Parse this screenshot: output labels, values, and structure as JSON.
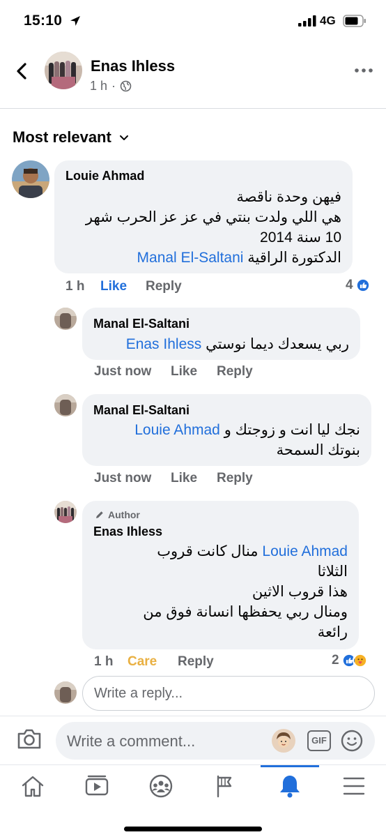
{
  "status_bar": {
    "time": "15:10",
    "network": "4G"
  },
  "header": {
    "name": "Enas Ihless",
    "time": "1 h"
  },
  "sort": {
    "label": "Most relevant"
  },
  "comments": [
    {
      "name": "Louie Ahmad",
      "lines": [
        "فيهن وحدة ناقصة",
        "هي اللي ولدت بنتي في عز عز الحرب شهر",
        "10 سنة 2014"
      ],
      "last_line_text": "الدكتورة الراقية",
      "mention": "Manal El-Saltani",
      "time": "1 h",
      "like": "Like",
      "reply": "Reply",
      "reaction_count": "4"
    },
    {
      "name": "Manal El-Saltani",
      "mention": "Enas Ihless",
      "text": "ربي يسعدك ديما نوستي",
      "time": "Just now",
      "like": "Like",
      "reply": "Reply"
    },
    {
      "name": "Manal El-Saltani",
      "mention": "Louie Ahmad",
      "text": "نجك ليا انت و زوجتك و",
      "line2": "بنوتك السمحة",
      "time": "Just now",
      "like": "Like",
      "reply": "Reply"
    },
    {
      "author_badge": "Author",
      "name": "Enas Ihless",
      "mention": "Louie Ahmad",
      "text": "منال كانت قروب",
      "lines": [
        "الثلاثا",
        "هذا قروب الاثين",
        "ومنال ربي يحفظها انسانة فوق من",
        "رائعة"
      ],
      "time": "1 h",
      "care": "Care",
      "reply": "Reply",
      "reaction_count": "2"
    }
  ],
  "reply_input": {
    "placeholder": "Write a reply..."
  },
  "composer": {
    "placeholder": "Write a comment...",
    "gif_label": "GIF"
  },
  "tabs": [
    "home",
    "watch",
    "groups",
    "pages",
    "notifications",
    "menu"
  ],
  "colors": {
    "accent": "#216fdb",
    "care": "#e9b042",
    "muted": "#65676b",
    "bubble": "#f0f2f5"
  }
}
